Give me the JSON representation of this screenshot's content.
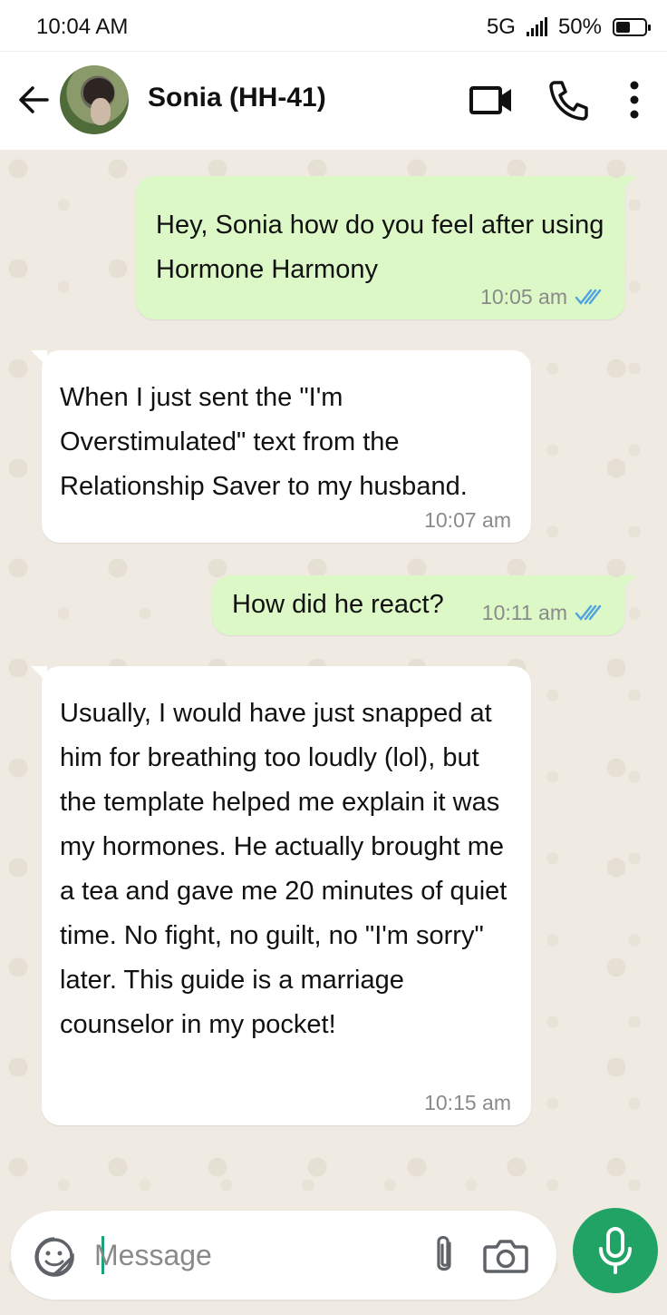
{
  "status_bar": {
    "time": "10:04 AM",
    "network": "5G",
    "battery": "50%",
    "battery_level": 0.5
  },
  "header": {
    "contact_name": "Sonia (HH-41)"
  },
  "messages": [
    {
      "direction": "outgoing",
      "text": "Hey, Sonia how do you feel after using Hormone Harmony",
      "time": "10:05 am",
      "status": "read"
    },
    {
      "direction": "incoming",
      "text": "When I just sent the \"I'm Overstimulated\" text from the Relationship Saver to my husband.",
      "time": "10:07 am"
    },
    {
      "direction": "outgoing",
      "text": "How did he react?",
      "time": "10:11 am",
      "status": "read"
    },
    {
      "direction": "incoming",
      "text": "Usually, I would have just snapped at him for breathing too loudly (lol), but the template helped me explain it was my hormones. He actually brought me a tea and gave me 20 minutes of quiet time.  No fight, no guilt, no \"I'm sorry\" later. This guide is a marriage counselor in my pocket!",
      "time": "10:15 am"
    }
  ],
  "composer": {
    "placeholder": "Message",
    "value": ""
  },
  "icons": [
    "back-arrow-icon",
    "video-call-icon",
    "phone-icon",
    "more-vert-icon",
    "emoji-sticker-icon",
    "attach-icon",
    "camera-icon",
    "mic-icon",
    "double-check-icon"
  ],
  "colors": {
    "outgoing_bubble": "#dcf8c6",
    "incoming_bubble": "#ffffff",
    "read_tick": "#4fa3e0",
    "mic_button": "#21a366",
    "chat_background": "#efeae2"
  }
}
